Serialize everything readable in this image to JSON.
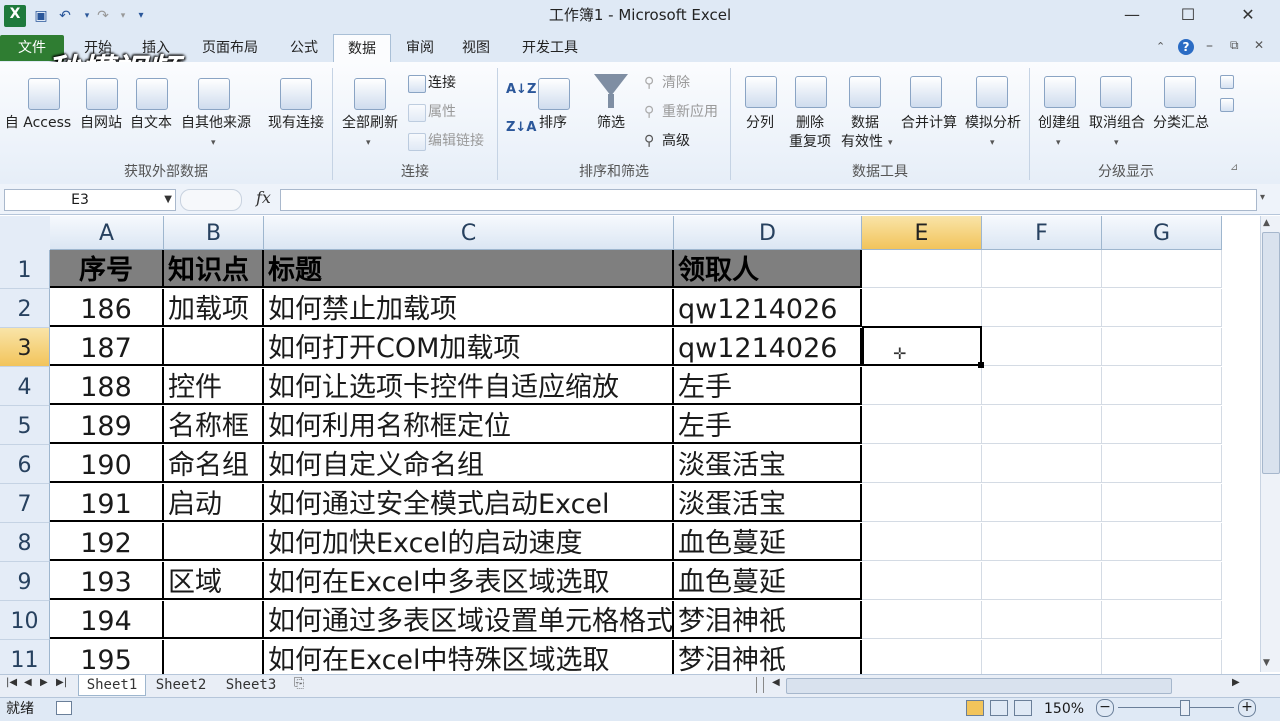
{
  "window": {
    "title": "工作簿1 - Microsoft Excel"
  },
  "tabs": [
    "文件",
    "开始",
    "插入",
    "页面布局",
    "公式",
    "数据",
    "审阅",
    "视图",
    "开发工具"
  ],
  "watermark": "秒懂视频",
  "ribbon": {
    "get_external": {
      "label": "获取外部数据",
      "buttons": [
        "自 Access",
        "自网站",
        "自文本",
        "自其他来源",
        "现有连接"
      ]
    },
    "connections": {
      "label": "连接",
      "refresh_all": "全部刷新",
      "connections": "连接",
      "properties": "属性",
      "edit_links": "编辑链接"
    },
    "sort_filter": {
      "label": "排序和筛选",
      "sort": "排序",
      "filter": "筛选",
      "clear": "清除",
      "reapply": "重新应用",
      "advanced": "高级"
    },
    "data_tools": {
      "label": "数据工具",
      "text_to_columns": "分列",
      "remove_dup_1": "删除",
      "remove_dup_2": "重复项",
      "validation_1": "数据",
      "validation_2": "有效性",
      "consolidate": "合并计算",
      "what_if": "模拟分析"
    },
    "outline": {
      "label": "分级显示",
      "group": "创建组",
      "ungroup": "取消组合",
      "subtotal": "分类汇总"
    }
  },
  "formula_bar": {
    "name_box": "E3",
    "fx": "fx",
    "content": ""
  },
  "columns": [
    "A",
    "B",
    "C",
    "D",
    "E",
    "F",
    "G"
  ],
  "rows": [
    {
      "n": "1",
      "a": "序号",
      "b": "知识点",
      "c": "标题",
      "d": "领取人"
    },
    {
      "n": "2",
      "a": "186",
      "b": "加载项",
      "c": "如何禁止加载项",
      "d": "qw1214026"
    },
    {
      "n": "3",
      "a": "187",
      "b": "",
      "c": "如何打开COM加载项",
      "d": "qw1214026"
    },
    {
      "n": "4",
      "a": "188",
      "b": "控件",
      "c": "如何让选项卡控件自适应缩放",
      "d": "左手"
    },
    {
      "n": "5",
      "a": "189",
      "b": "名称框",
      "c": "如何利用名称框定位",
      "d": "左手"
    },
    {
      "n": "6",
      "a": "190",
      "b": "命名组",
      "c": "如何自定义命名组",
      "d": "淡蛋活宝"
    },
    {
      "n": "7",
      "a": "191",
      "b": "启动",
      "c": "如何通过安全模式启动Excel",
      "d": "淡蛋活宝"
    },
    {
      "n": "8",
      "a": "192",
      "b": "",
      "c": "如何加快Excel的启动速度",
      "d": "血色蔓延"
    },
    {
      "n": "9",
      "a": "193",
      "b": "区域",
      "c": "如何在Excel中多表区域选取",
      "d": "血色蔓延"
    },
    {
      "n": "10",
      "a": "194",
      "b": "",
      "c": "如何通过多表区域设置单元格格式",
      "d": "梦泪神祇"
    },
    {
      "n": "11",
      "a": "195",
      "b": "",
      "c": "如何在Excel中特殊区域选取",
      "d": "梦泪神祇"
    }
  ],
  "selection": {
    "column": "E",
    "row": "3"
  },
  "sheets": [
    "Sheet1",
    "Sheet2",
    "Sheet3"
  ],
  "status": {
    "ready": "就绪",
    "zoom": "150%"
  },
  "colors": {
    "file_tab": "#2f7d32",
    "header_fill": "#7f7f7f",
    "selected_header": "#f2c45b"
  }
}
